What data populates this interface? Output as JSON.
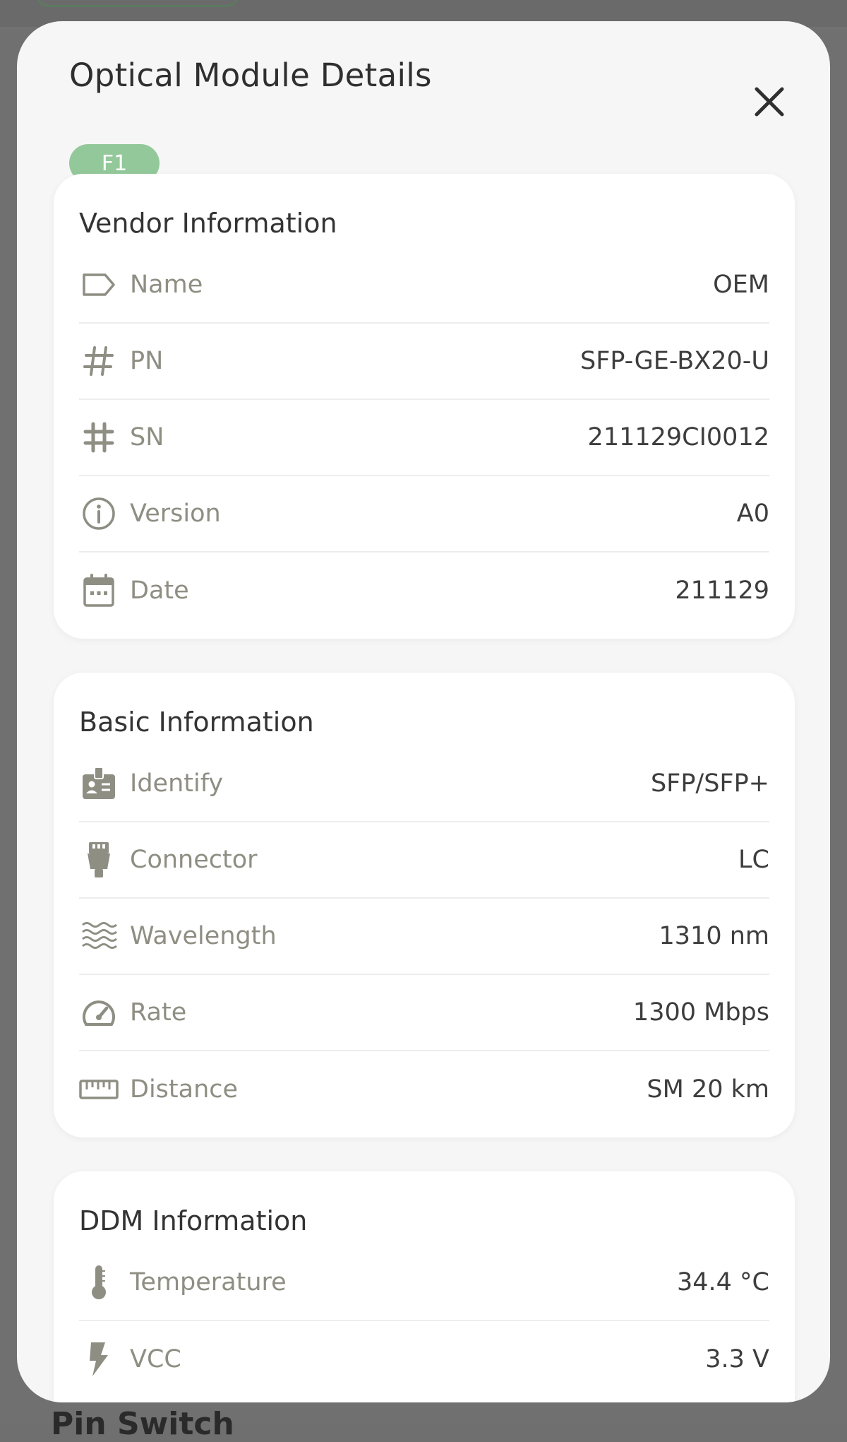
{
  "sheet": {
    "title": "Optical Module Details",
    "badge": "F1"
  },
  "vendor": {
    "title": "Vendor Information",
    "rows": [
      {
        "label": "Name",
        "value": "OEM",
        "icon": "tag-icon"
      },
      {
        "label": "PN",
        "value": "SFP-GE-BX20-U",
        "icon": "hash-icon"
      },
      {
        "label": "SN",
        "value": "211129CI0012",
        "icon": "hash-bold-icon"
      },
      {
        "label": "Version",
        "value": "A0",
        "icon": "info-icon"
      },
      {
        "label": "Date",
        "value": "211129",
        "icon": "calendar-icon"
      }
    ]
  },
  "basic": {
    "title": "Basic Information",
    "rows": [
      {
        "label": "Identify",
        "value": "SFP/SFP+",
        "icon": "id-badge-icon"
      },
      {
        "label": "Connector",
        "value": "LC",
        "icon": "connector-icon"
      },
      {
        "label": "Wavelength",
        "value": "1310 nm",
        "icon": "waves-icon"
      },
      {
        "label": "Rate",
        "value": "1300 Mbps",
        "icon": "speedometer-icon"
      },
      {
        "label": "Distance",
        "value": "SM 20 km",
        "icon": "ruler-icon"
      }
    ]
  },
  "ddm": {
    "title": "DDM Information",
    "rows": [
      {
        "label": "Temperature",
        "value": "34.4 °C",
        "icon": "thermometer-icon"
      },
      {
        "label": "VCC",
        "value": "3.3 V",
        "icon": "lightning-icon"
      }
    ]
  },
  "background": {
    "partial_text": "Pin Switch"
  },
  "colors": {
    "badge": "#93c99a",
    "icon": "#8e8e83",
    "sheet": "#f6f6f6"
  }
}
